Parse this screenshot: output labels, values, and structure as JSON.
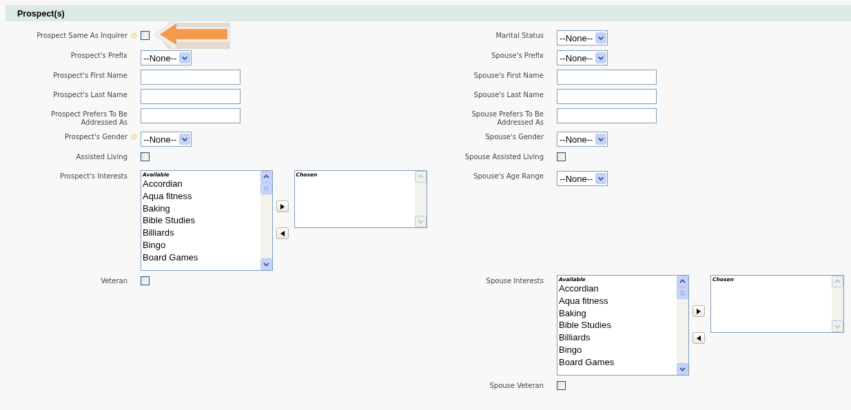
{
  "section": {
    "title": "Prospect(s)"
  },
  "rows": [
    {
      "left": {
        "kind": "checkbox",
        "label": "Prospect Same As Inquirer",
        "help": true,
        "checked": false,
        "callout_arrow": true
      },
      "right": {
        "kind": "select",
        "label": "Marital Status",
        "value": "--None--"
      }
    },
    {
      "left": {
        "kind": "select",
        "label": "Prospect's Prefix",
        "value": "--None--"
      },
      "right": {
        "kind": "select",
        "label": "Spouse's Prefix",
        "value": "--None--"
      }
    },
    {
      "left": {
        "kind": "text",
        "label": "Prospect's First Name"
      },
      "right": {
        "kind": "text",
        "label": "Spouse's First Name"
      }
    },
    {
      "left": {
        "kind": "text",
        "label": "Prospect's Last Name"
      },
      "right": {
        "kind": "text",
        "label": "Spouse's Last Name"
      }
    },
    {
      "left": {
        "kind": "text",
        "label": "Prospect Prefers To Be Addressed As"
      },
      "right": {
        "kind": "text",
        "label": "Spouse Prefers To Be Addressed As"
      }
    },
    {
      "left": {
        "kind": "select",
        "label": "Prospect's Gender",
        "help": true,
        "value": "--None--"
      },
      "right": {
        "kind": "select",
        "label": "Spouse's Gender",
        "value": "--None--"
      }
    },
    {
      "left": {
        "kind": "checkbox",
        "label": "Assisted Living",
        "checked": false
      },
      "right": {
        "kind": "checkbox",
        "label": "Spouse Assisted Living",
        "checked": false
      }
    },
    {
      "left": {
        "kind": "multiselect",
        "label": "Prospect's Interests",
        "available_header": "Available",
        "options": [
          "Accordian",
          "Aqua fitness",
          "Baking",
          "Bible Studies",
          "Billiards",
          "Bingo",
          "Board Games"
        ],
        "chosen_header": "Chosen"
      },
      "right": {
        "kind": "select",
        "label": "Spouse's Age Range",
        "value": "--None--"
      }
    },
    {
      "left": {
        "kind": "checkbox",
        "label": "Veteran",
        "checked": false
      },
      "right": {
        "kind": "multiselect",
        "label": "Spouse Interests",
        "available_header": "Available",
        "options": [
          "Accordian",
          "Aqua fitness",
          "Baking",
          "Bible Studies",
          "Billiards",
          "Bingo",
          "Board Games"
        ],
        "chosen_header": "Chosen"
      }
    },
    {
      "right": {
        "kind": "checkbox",
        "label": "Spouse Veteran",
        "checked": false
      }
    }
  ]
}
